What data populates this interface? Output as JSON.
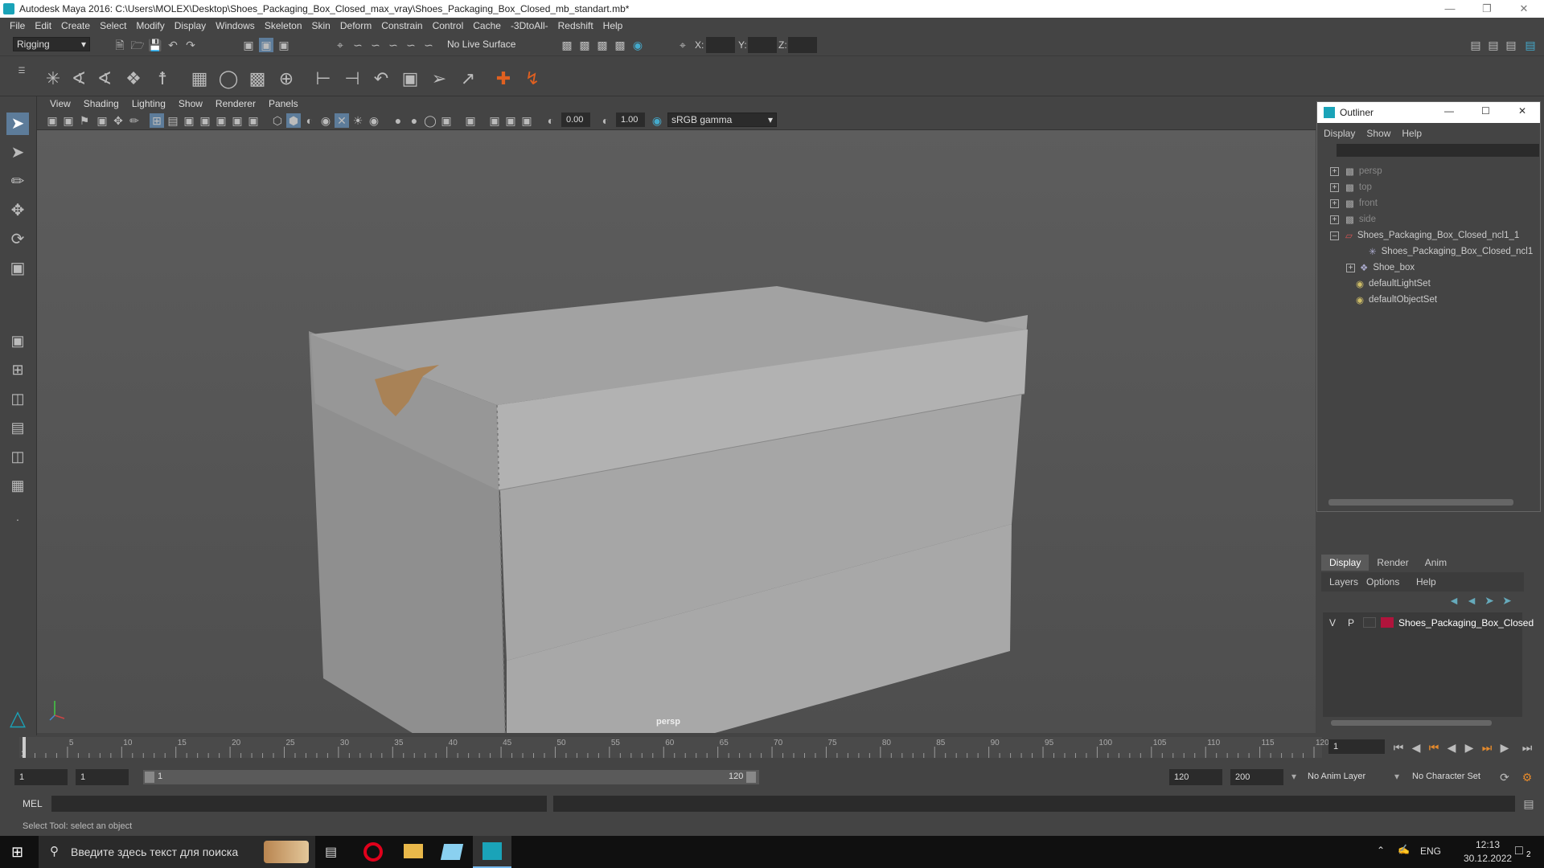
{
  "window": {
    "title": "Autodesk Maya 2016: C:\\Users\\MOLEX\\Desktop\\Shoes_Packaging_Box_Closed_max_vray\\Shoes_Packaging_Box_Closed_mb_standart.mb*"
  },
  "menu": [
    "File",
    "Edit",
    "Create",
    "Select",
    "Modify",
    "Display",
    "Windows",
    "Skeleton",
    "Skin",
    "Deform",
    "Constrain",
    "Control",
    "Cache",
    "-3DtoAll-",
    "Redshift",
    "Help"
  ],
  "status": {
    "mode": "Rigging",
    "live_surface": "No Live Surface",
    "x_label": "X:",
    "y_label": "Y:",
    "z_label": "Z:"
  },
  "viewport": {
    "menus": [
      "View",
      "Shading",
      "Lighting",
      "Show",
      "Renderer",
      "Panels"
    ],
    "exposure": "0.00",
    "gamma": "1.00",
    "colorspace": "sRGB gamma",
    "camera_label": "persp"
  },
  "outliner": {
    "title": "Outliner",
    "menus": [
      "Display",
      "Show",
      "Help"
    ],
    "items": [
      {
        "label": "persp",
        "icon": "camera-icon",
        "dim": true
      },
      {
        "label": "top",
        "icon": "camera-icon",
        "dim": true
      },
      {
        "label": "front",
        "icon": "camera-icon",
        "dim": true
      },
      {
        "label": "side",
        "icon": "camera-icon",
        "dim": true
      },
      {
        "label": "Shoes_Packaging_Box_Closed_ncl1_1",
        "icon": "group-icon",
        "dim": false
      },
      {
        "label": "Shoes_Packaging_Box_Closed_ncl1",
        "icon": "locator-icon",
        "dim": false
      },
      {
        "label": "Shoe_box",
        "icon": "mesh-icon",
        "dim": false
      },
      {
        "label": "defaultLightSet",
        "icon": "set-icon",
        "dim": false
      },
      {
        "label": "defaultObjectSet",
        "icon": "set-icon",
        "dim": false
      }
    ]
  },
  "layers": {
    "tabs": [
      "Display",
      "Render",
      "Anim"
    ],
    "menus": [
      "Layers",
      "Options",
      "Help"
    ],
    "row": {
      "v": "V",
      "p": "P",
      "name": "Shoes_Packaging_Box_Closed",
      "color": "#b0143c"
    }
  },
  "timeline": {
    "ticks": [
      "5",
      "10",
      "15",
      "20",
      "25",
      "30",
      "35",
      "40",
      "45",
      "50",
      "55",
      "60",
      "65",
      "70",
      "75",
      "80",
      "85",
      "90",
      "95",
      "100",
      "105",
      "110",
      "115",
      "120"
    ],
    "start_mark": "1",
    "current_frame": "1"
  },
  "range": {
    "start": "1",
    "inner_start": "1",
    "slider_start": "1",
    "slider_end": "120",
    "end": "120",
    "max": "200",
    "anim_layer": "No Anim Layer",
    "char_set": "No Character Set"
  },
  "cmd": {
    "label": "MEL"
  },
  "help": "Select Tool: select an object",
  "taskbar": {
    "search": "Введите здесь текст для поиска",
    "lang": "ENG",
    "time": "12:13",
    "date": "30.12.2022",
    "notif": "2"
  }
}
